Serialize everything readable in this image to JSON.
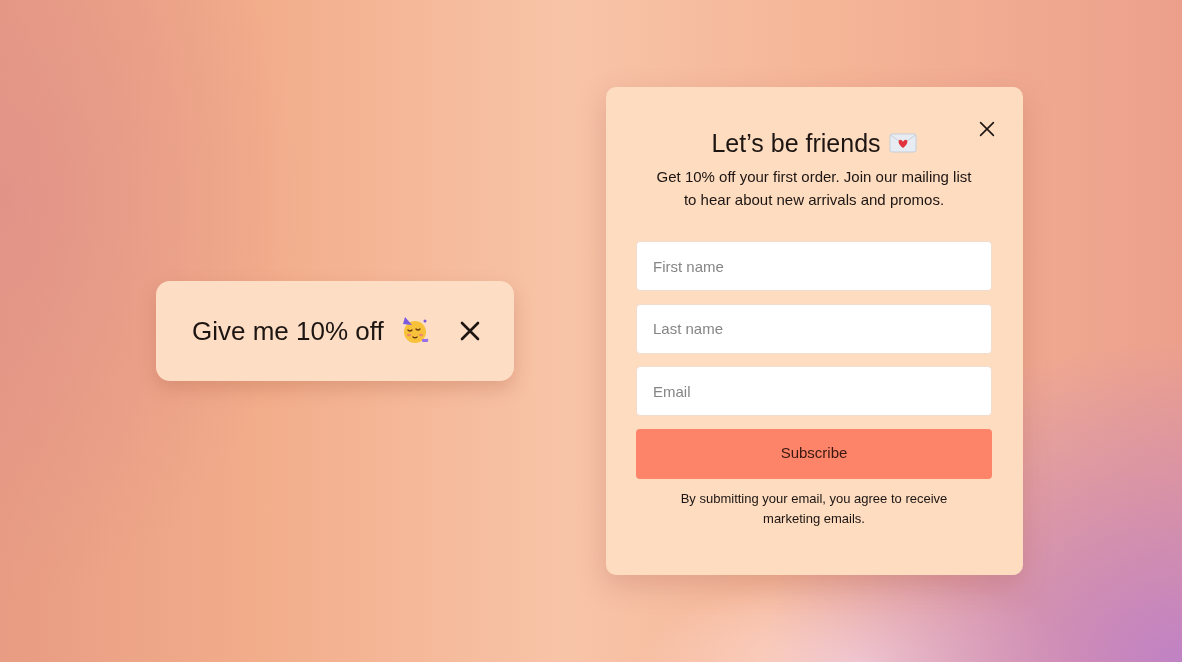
{
  "teaser": {
    "label": "Give me 10% off"
  },
  "popup": {
    "title": "Let’s be friends",
    "subtitle": "Get 10% off your first order. Join our mailing list to hear about new arrivals and promos.",
    "fields": [
      {
        "placeholder": "First name"
      },
      {
        "placeholder": "Last name"
      },
      {
        "placeholder": "Email"
      }
    ],
    "submit": "Subscribe",
    "disclaimer": "By submitting your email, you agree to receive marketing emails."
  }
}
